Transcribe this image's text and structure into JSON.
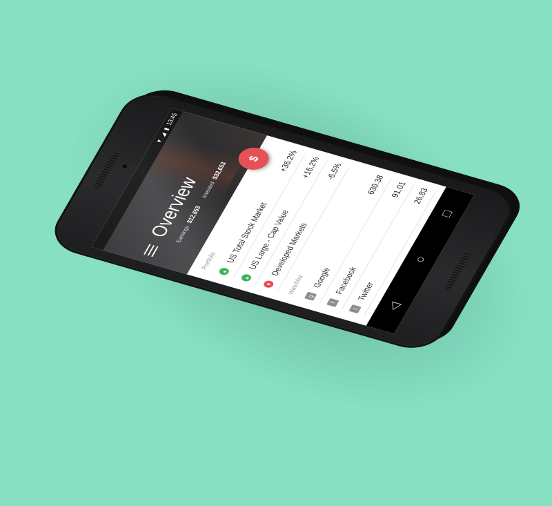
{
  "status": {
    "time": "13:45"
  },
  "header": {
    "title": "Overview",
    "earnings_label": "Earnings",
    "earnings_value": "$12,653",
    "invested_label": "Invested",
    "invested_value": "$32,653",
    "fab_label": "$"
  },
  "portfolio": {
    "label": "Portfolio",
    "items": [
      {
        "name": "US Total Stock Market",
        "change": "+36.2%",
        "trend": "up"
      },
      {
        "name": "US Large - Cap Value",
        "change": "+16.2%",
        "trend": "up"
      },
      {
        "name": "Developed Markets",
        "change": "-6.5%",
        "trend": "down"
      }
    ]
  },
  "watchlist": {
    "label": "Watchlist",
    "items": [
      {
        "name": "Google",
        "price": "630.38",
        "icon": "google-icon",
        "glyph": "g"
      },
      {
        "name": "Facebook",
        "price": "91.01",
        "icon": "facebook-icon",
        "glyph": "f"
      },
      {
        "name": "Twitter",
        "price": "26.83",
        "icon": "twitter-icon",
        "glyph": "t"
      }
    ]
  },
  "colors": {
    "background": "#88e0c3",
    "accent": "#e65157",
    "up": "#3cb55a",
    "down": "#e65157"
  }
}
